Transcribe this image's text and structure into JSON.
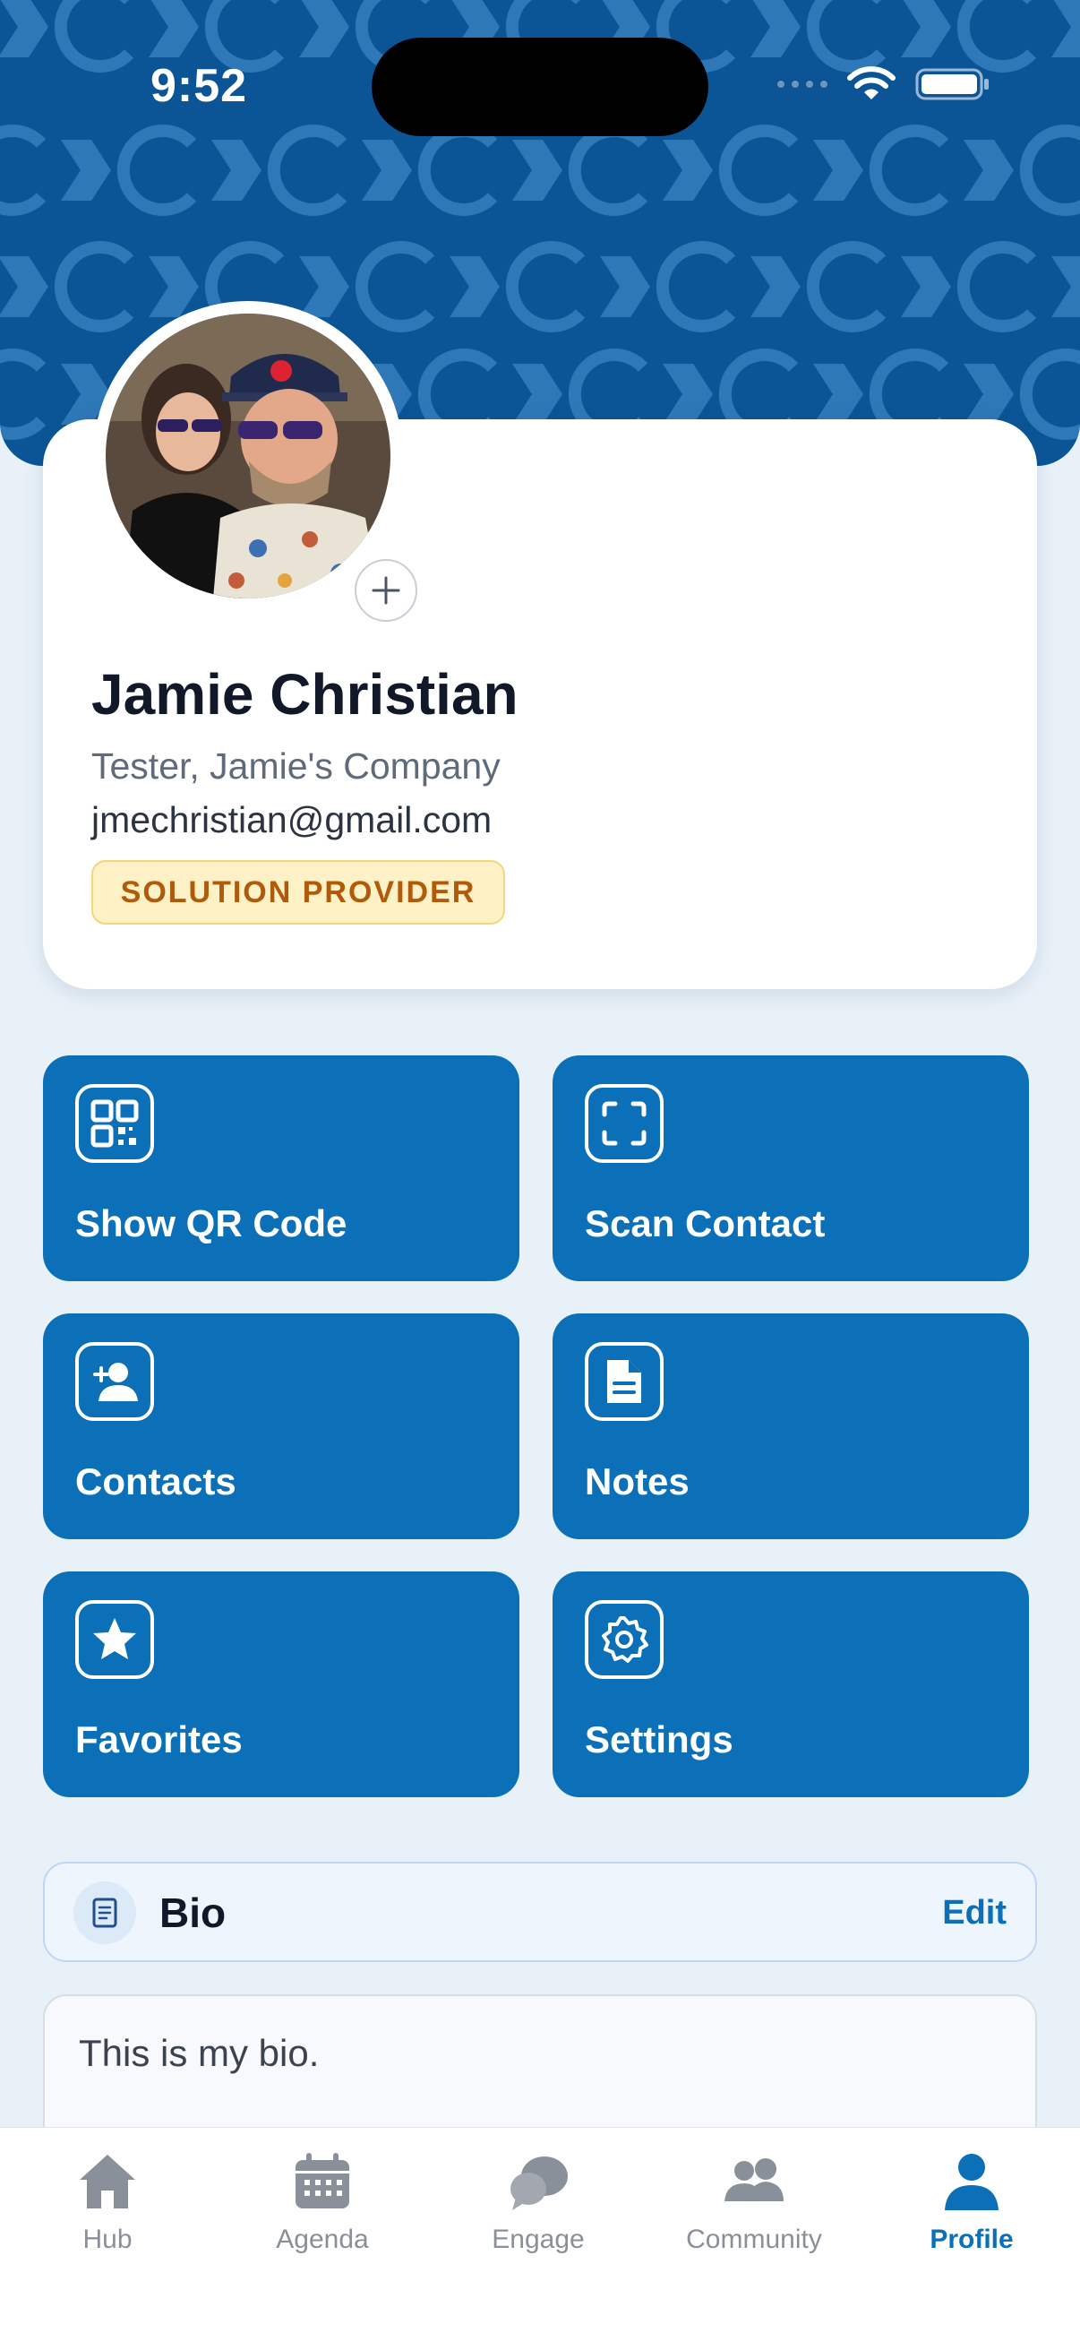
{
  "status_bar": {
    "time": "9:52"
  },
  "profile": {
    "name": "Jamie Christian",
    "role": "Tester, Jamie's Company",
    "email": "jmechristian@gmail.com",
    "badge": "SOLUTION PROVIDER"
  },
  "actions": [
    {
      "label": "Show QR Code",
      "icon": "qr-code-icon"
    },
    {
      "label": "Scan Contact",
      "icon": "scan-icon"
    },
    {
      "label": "Contacts",
      "icon": "add-contact-icon"
    },
    {
      "label": "Notes",
      "icon": "document-icon"
    },
    {
      "label": "Favorites",
      "icon": "star-icon"
    },
    {
      "label": "Settings",
      "icon": "gear-icon"
    }
  ],
  "bio": {
    "title": "Bio",
    "edit_label": "Edit",
    "text": "This is my bio."
  },
  "tabs": [
    {
      "label": "Hub",
      "icon": "home-icon",
      "active": false
    },
    {
      "label": "Agenda",
      "icon": "calendar-icon",
      "active": false
    },
    {
      "label": "Engage",
      "icon": "chat-icon",
      "active": false
    },
    {
      "label": "Community",
      "icon": "people-icon",
      "active": false
    },
    {
      "label": "Profile",
      "icon": "person-icon",
      "active": true
    }
  ],
  "colors": {
    "banner": "#0b5596",
    "tile": "#0b70b8",
    "accent": "#0b70b8",
    "badge_bg": "#fdf1c5",
    "badge_text": "#b05a0a",
    "background": "#e9f1f8"
  }
}
